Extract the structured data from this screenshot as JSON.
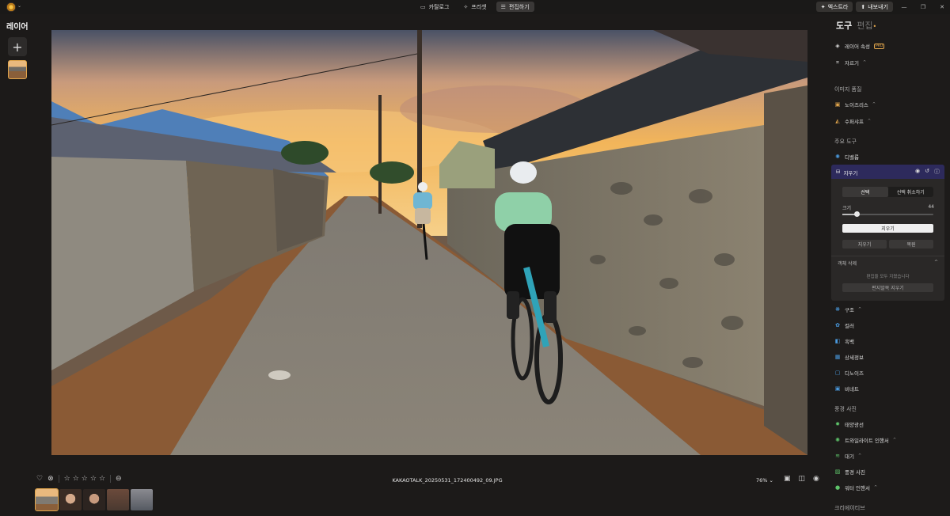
{
  "topbar": {
    "tabs": [
      {
        "label": "카탈로그",
        "icon": "catalog-icon"
      },
      {
        "label": "프리셋",
        "icon": "presets-icon"
      },
      {
        "label": "편집하기",
        "icon": "edit-icon"
      }
    ],
    "extra_label": "엑스트라",
    "export_label": "내보내기"
  },
  "layers": {
    "title": "레이어",
    "add": "+"
  },
  "photo": {
    "filename": "KAKAOTALK_20250531_172400492_09.JPG",
    "zoom": "76%"
  },
  "filmstrip": {
    "count": 5,
    "active": 0
  },
  "panel": {
    "tab_tools": "도구",
    "tab_edit": "편집",
    "layer_props": "레이어 속성",
    "layer_props_badge": "PRO",
    "crop": "자르기",
    "section_quality": "이미지 품질",
    "noiseless": "노이즈리스",
    "supersharp": "수퍼샤프",
    "section_main": "주요 도구",
    "develop": "디벨롭",
    "erase": "지우기",
    "erase_panel": {
      "seg_select": "선택",
      "seg_deselect": "선택 취소하기",
      "size_label": "크기",
      "size_value": "44",
      "size_fraction": 0.16,
      "erase_btn": "지우기",
      "erase2": "지우기",
      "restore": "복원",
      "object_delete": "객체 삭제",
      "hint": "편집을 모두 지웠습니다",
      "clear_all": "편지말목 지우기"
    },
    "structure": "구조",
    "color": "컬러",
    "bw": "흑백",
    "details": "상세정보",
    "denoise": "디노이즈",
    "vignette": "비네트",
    "section_landscape": "풍경 사진",
    "sunrays": "태양광선",
    "twilight": "트와일라이트 인핸서",
    "atmosphere": "대기",
    "landscape": "풍경 사진",
    "water": "워터 인핸서",
    "section_creative": "크리에이티브"
  },
  "colors": {
    "accent": "#e2a64c",
    "erase_header": "#2d2a5c"
  }
}
